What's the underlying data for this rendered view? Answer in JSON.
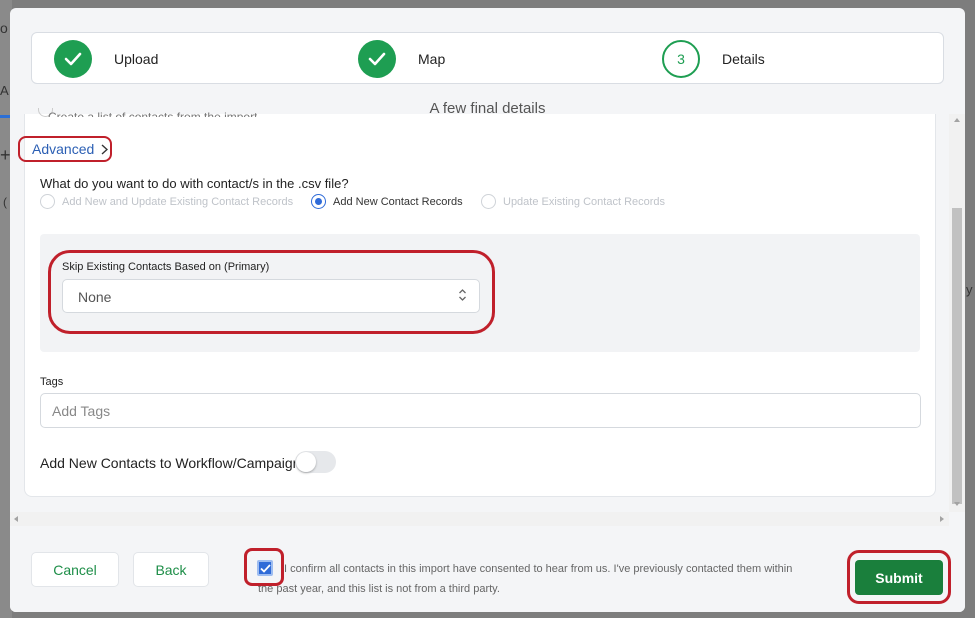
{
  "steps": [
    {
      "label": "Upload",
      "status": "done"
    },
    {
      "label": "Map",
      "status": "done"
    },
    {
      "number": "3",
      "label": "Details",
      "status": "current"
    }
  ],
  "subtitle": "A few final details",
  "cut_off_option": "Create a list of contacts from the import",
  "advanced_label": "Advanced",
  "question": "What do you want to do with contact/s in the .csv file?",
  "radio_options": [
    {
      "label": "Add New and Update Existing Contact Records",
      "selected": false,
      "disabled": true
    },
    {
      "label": "Add New Contact Records",
      "selected": true,
      "disabled": false
    },
    {
      "label": "Update Existing Contact Records",
      "selected": false,
      "disabled": true
    }
  ],
  "skip": {
    "label": "Skip Existing Contacts Based on (Primary)",
    "value": "None"
  },
  "tags": {
    "label": "Tags",
    "placeholder": "Add Tags"
  },
  "workflow": {
    "label": "Add New Contacts to Workflow/Campaign",
    "enabled": false
  },
  "footer": {
    "cancel_label": "Cancel",
    "back_label": "Back",
    "consent_text": "I confirm all contacts in this import have consented to hear from us. I've previously contacted them within the past year, and this list is not from a third party.",
    "consent_checked": true,
    "submit_label": "Submit"
  },
  "background_fragments": [
    "o",
    "A",
    "+",
    "(",
    "y"
  ],
  "colors": {
    "primary_green": "#1e9e52",
    "submit_green": "#1a7f3c",
    "link_blue": "#2b5fb4",
    "radio_blue": "#2f6bd8",
    "highlight_red": "#c0202b"
  }
}
